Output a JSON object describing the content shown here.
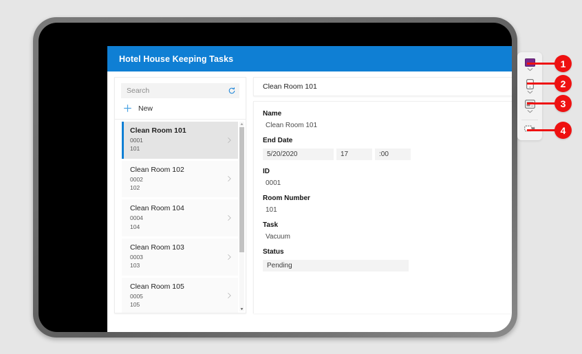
{
  "app": {
    "header": {
      "title": "Hotel House Keeping Tasks"
    },
    "search": {
      "placeholder": "Search",
      "value": "",
      "refresh_icon": "refresh-icon"
    },
    "new_button": {
      "label": "New",
      "icon": "plus-icon"
    },
    "list": {
      "items": [
        {
          "title": "Clean Room 101",
          "id": "0001",
          "room": "101",
          "selected": true
        },
        {
          "title": "Clean Room 102",
          "id": "0002",
          "room": "102",
          "selected": false
        },
        {
          "title": "Clean Room 104",
          "id": "0004",
          "room": "104",
          "selected": false
        },
        {
          "title": "Clean Room 103",
          "id": "0003",
          "room": "103",
          "selected": false
        },
        {
          "title": "Clean Room 105",
          "id": "0005",
          "room": "105",
          "selected": false
        }
      ]
    },
    "detail": {
      "header_title": "Clean Room 101",
      "fields": [
        {
          "label": "Name",
          "value": "Clean Room 101"
        },
        {
          "label": "End Date",
          "date": "5/20/2020",
          "hour": "17",
          "minute": ":00"
        },
        {
          "label": "ID",
          "value": "0001"
        },
        {
          "label": "Room Number",
          "value": "101"
        },
        {
          "label": "Task",
          "value": "Vacuum"
        },
        {
          "label": "Status",
          "value": "Pending"
        }
      ]
    }
  },
  "device_switcher": {
    "items": [
      {
        "icon": "monitor-icon",
        "caret": "chevron-down-icon"
      },
      {
        "icon": "phone-icon",
        "caret": "chevron-down-icon"
      },
      {
        "icon": "tablet-icon",
        "caret": "chevron-down-icon"
      },
      {
        "icon": "camera-capture-icon",
        "caret": ""
      }
    ]
  },
  "callouts": [
    {
      "number": "1"
    },
    {
      "number": "2"
    },
    {
      "number": "3"
    },
    {
      "number": "4"
    }
  ],
  "colors": {
    "header_blue": "#0f7fd4",
    "accent_blue": "#0f7fd4",
    "callout_red": "#ee1111",
    "monitor_purple": "#7a2a8c",
    "page_background": "#e6e6e6"
  }
}
